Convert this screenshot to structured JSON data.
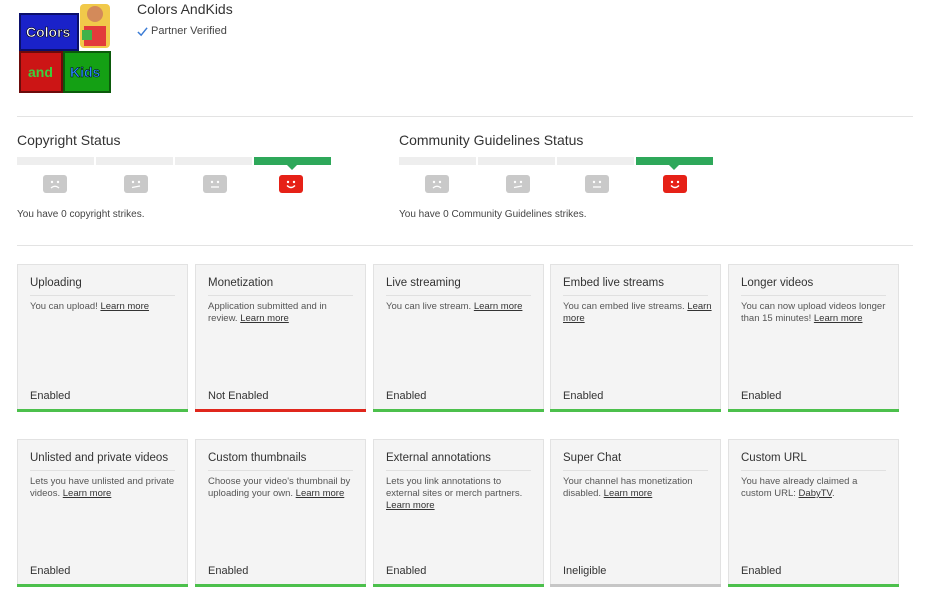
{
  "channel": {
    "name": "Colors AndKids",
    "verified_label": "Partner Verified",
    "logo_text": {
      "top": "Colors",
      "bottom_left": "and",
      "bottom_right": "Kids"
    }
  },
  "copyright": {
    "title": "Copyright Status",
    "strike_text": "You have 0 copyright strikes.",
    "active_index": 3
  },
  "community": {
    "title": "Community Guidelines Status",
    "strike_text": "You have 0 Community Guidelines strikes.",
    "active_index": 3
  },
  "features": [
    {
      "title": "Uploading",
      "desc": "You can upload! ",
      "link": "Learn more",
      "status": "Enabled",
      "bar": "#4cc04c"
    },
    {
      "title": "Monetization",
      "desc": "Application submitted and in review. ",
      "link": "Learn more",
      "status": "Not Enabled",
      "bar": "#e0261c"
    },
    {
      "title": "Live streaming",
      "desc": "You can live stream. ",
      "link": "Learn more",
      "status": "Enabled",
      "bar": "#4cc04c"
    },
    {
      "title": "Embed live streams",
      "desc": "You can embed live streams. ",
      "link": "Learn more",
      "status": "Enabled",
      "bar": "#4cc04c"
    },
    {
      "title": "Longer videos",
      "desc": "You can now upload videos longer than 15 minutes! ",
      "link": "Learn more",
      "status": "Enabled",
      "bar": "#4cc04c"
    },
    {
      "title": "Unlisted and private videos",
      "desc": "Lets you have unlisted and private videos. ",
      "link": "Learn more",
      "status": "Enabled",
      "bar": "#4cc04c"
    },
    {
      "title": "Custom thumbnails",
      "desc": "Choose your video's thumbnail by uploading your own. ",
      "link": "Learn more",
      "status": "Enabled",
      "bar": "#4cc04c"
    },
    {
      "title": "External annotations",
      "desc": "Lets you link annotations to external sites or merch partners. ",
      "link": "Learn more",
      "status": "Enabled",
      "bar": "#4cc04c"
    },
    {
      "title": "Super Chat",
      "desc": "Your channel has monetization disabled. ",
      "link": "Learn more",
      "status": "Ineligible",
      "bar": "#c6c6c6"
    },
    {
      "title": "Custom URL",
      "desc": "You have already claimed a custom URL: ",
      "link": "DabyTV",
      "link_suffix": ".",
      "status": "Enabled",
      "bar": "#4cc04c"
    }
  ]
}
